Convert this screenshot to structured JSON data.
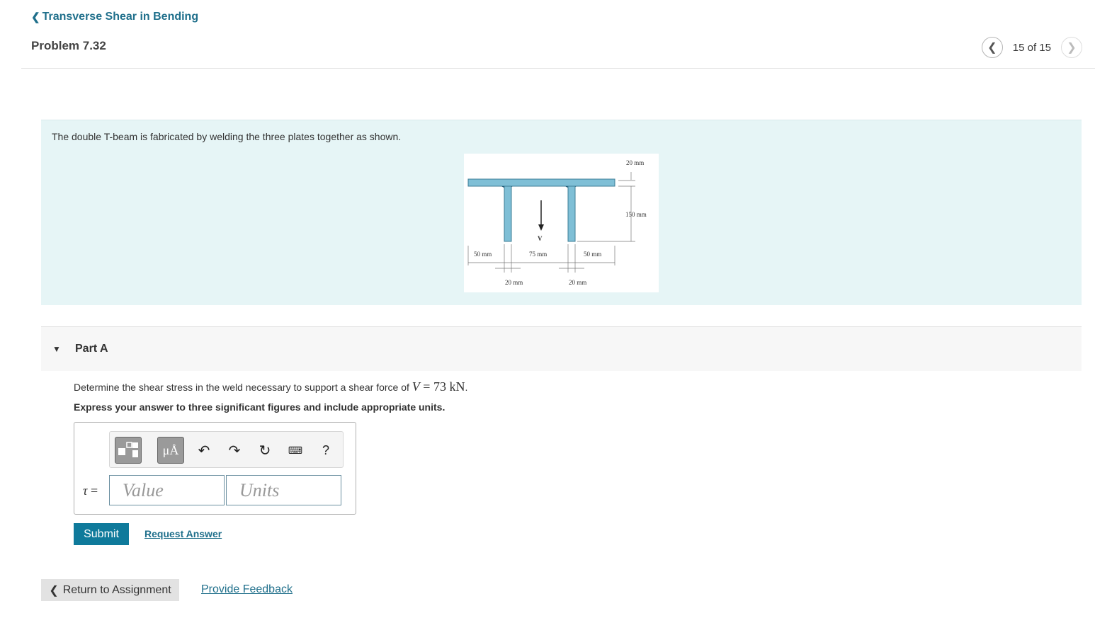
{
  "header": {
    "back_link": "Transverse Shear in Bending",
    "problem_title": "Problem 7.32",
    "pager_text": "15 of 15"
  },
  "problem": {
    "statement": "The double T-beam is fabricated by welding the three plates together as shown.",
    "figure_labels": {
      "dim_top": "20 mm",
      "dim_right": "150 mm",
      "dim_left": "50 mm",
      "dim_mid": "75 mm",
      "dim_right_bottom": "50 mm",
      "dim_web_left": "20 mm",
      "dim_web_right": "20 mm",
      "force": "V"
    },
    "figure_colors": {
      "plate": "#7fbfd6",
      "plate_edge": "#3c7d96",
      "weld": "#1c5570"
    }
  },
  "part": {
    "label": "Part A",
    "question_prefix": "Determine the shear stress in the weld necessary to support a shear force of ",
    "question_var": "V",
    "question_value": " = 73 kN",
    "question_suffix": ".",
    "instruction": "Express your answer to three significant figures and include appropriate units."
  },
  "answer": {
    "symbol": "τ",
    "equals": " =",
    "value_placeholder": "Value",
    "units_placeholder": "Units",
    "units_button": "μÅ",
    "help_button": "?"
  },
  "actions": {
    "submit": "Submit",
    "request_answer": "Request Answer",
    "return": "Return to Assignment",
    "feedback": "Provide Feedback"
  },
  "colors": {
    "accent": "#0f7a9b",
    "link": "#1f6f8b",
    "problem_bg": "#e6f5f6"
  }
}
